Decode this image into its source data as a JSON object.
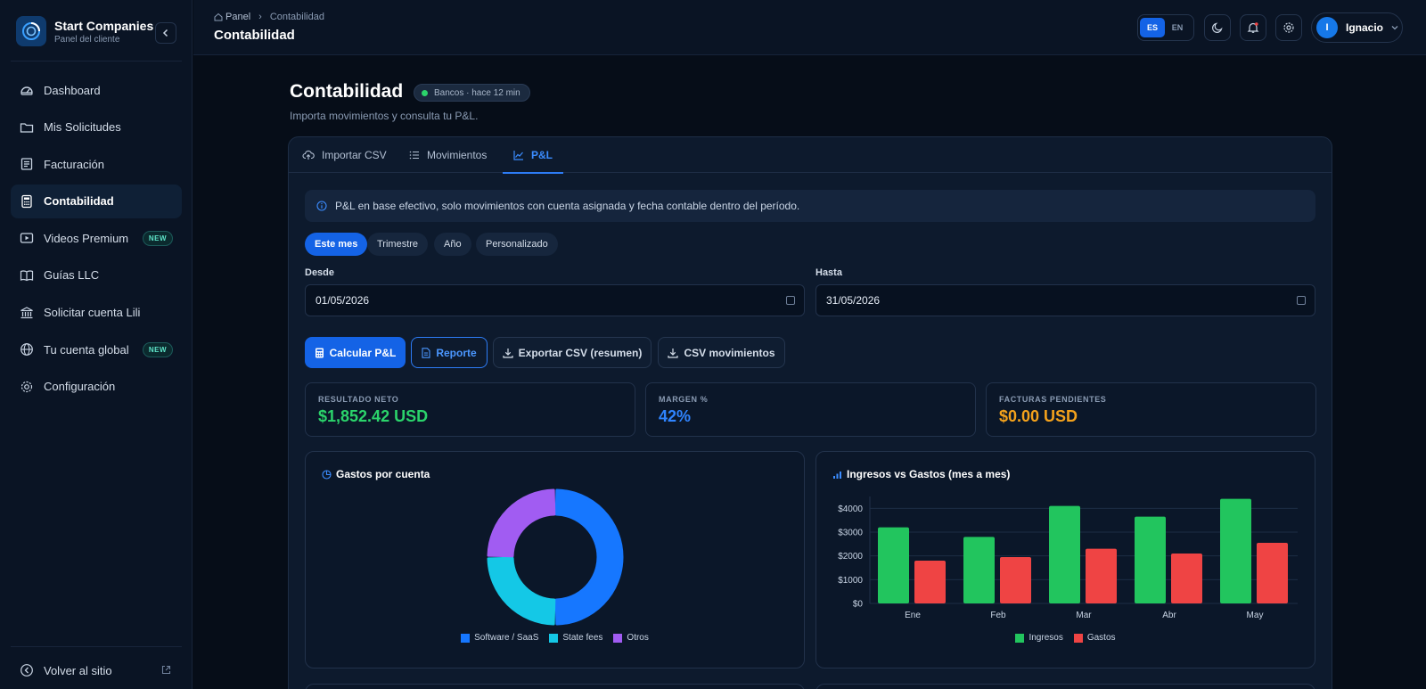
{
  "brand": {
    "title": "Start Companies",
    "subtitle": "Panel del cliente"
  },
  "sidebar": {
    "items": [
      {
        "label": "Dashboard",
        "icon": "dashboard-icon"
      },
      {
        "label": "Mis Solicitudes",
        "icon": "folder-icon"
      },
      {
        "label": "Facturación",
        "icon": "invoice-icon"
      },
      {
        "label": "Contabilidad",
        "icon": "calculator-icon",
        "active": true
      },
      {
        "label": "Videos Premium",
        "icon": "video-icon",
        "badge": "NEW"
      },
      {
        "label": "Guías LLC",
        "icon": "book-icon"
      },
      {
        "label": "Solicitar cuenta Lili",
        "icon": "bank-icon"
      },
      {
        "label": "Tu cuenta global",
        "icon": "globe-icon",
        "badge": "NEW"
      },
      {
        "label": "Configuración",
        "icon": "gear-icon"
      }
    ],
    "back": "Volver al sitio"
  },
  "topbar": {
    "crumb_home": "Panel",
    "crumb_current": "Contabilidad",
    "title": "Contabilidad",
    "lang_es": "ES",
    "lang_en": "EN",
    "user_initial": "I",
    "user_name": "Ignacio"
  },
  "header": {
    "title": "Contabilidad",
    "status": "Bancos · hace 12 min",
    "subtitle": "Importa movimientos y consulta tu P&L."
  },
  "tabs": [
    "Importar CSV",
    "Movimientos",
    "P&L"
  ],
  "info": "P&L en base efectivo, solo movimientos con cuenta asignada y fecha contable dentro del período.",
  "periods": [
    "Este mes",
    "Trimestre",
    "Año",
    "Personalizado"
  ],
  "filters": {
    "from_label": "Desde",
    "from_value": "01/05/2026",
    "to_label": "Hasta",
    "to_value": "31/05/2026"
  },
  "actions": [
    "Calcular P&L",
    "Reporte",
    "Exportar CSV (resumen)",
    "CSV movimientos"
  ],
  "kpis": [
    {
      "label": "RESULTADO NETO",
      "value": "$1,852.42 USD",
      "color": "#2bd46b"
    },
    {
      "label": "MARGEN %",
      "value": "42%",
      "color": "#2f84ff"
    },
    {
      "label": "FACTURAS PENDIENTES",
      "value": "$0.00 USD",
      "color": "#f4a21c"
    }
  ],
  "colors": {
    "accent": "#1463e6",
    "green": "#22c55e",
    "red": "#ef4444"
  },
  "chart_data": [
    {
      "type": "pie",
      "title": "Gastos por cuenta",
      "donut": true,
      "categories": [
        "Software / SaaS",
        "State fees",
        "Otros"
      ],
      "values": [
        50,
        25,
        25
      ],
      "colors": [
        "#1677ff",
        "#14c8e6",
        "#a15cf2"
      ],
      "legend": "bottom"
    },
    {
      "type": "bar",
      "title": "Ingresos vs Gastos (mes a mes)",
      "categories": [
        "Ene",
        "Feb",
        "Mar",
        "Abr",
        "May"
      ],
      "series": [
        {
          "name": "Ingresos",
          "values": [
            3200,
            2800,
            4100,
            3650,
            4400
          ],
          "color": "#22c55e"
        },
        {
          "name": "Gastos",
          "values": [
            1800,
            1950,
            2300,
            2100,
            2550
          ],
          "color": "#ef4444"
        }
      ],
      "y_ticks": [
        "$0",
        "$1000",
        "$2000",
        "$3000",
        "$4000"
      ],
      "ylim": [
        0,
        4500
      ],
      "grid": true,
      "legend": "bottom"
    }
  ]
}
